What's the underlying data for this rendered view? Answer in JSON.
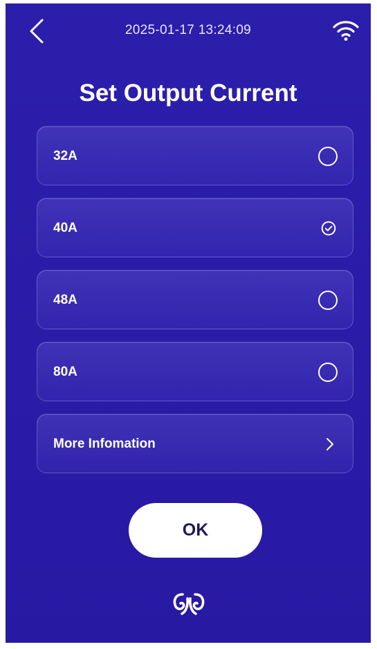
{
  "status_bar": {
    "datetime": "2025-01-17 13:24:09",
    "back_icon": "chevron-left-icon",
    "wifi_icon": "wifi-icon"
  },
  "title": "Set Output Current",
  "options": [
    {
      "label": "32A",
      "selected": false
    },
    {
      "label": "40A",
      "selected": true
    },
    {
      "label": "48A",
      "selected": false
    },
    {
      "label": "80A",
      "selected": false
    }
  ],
  "more_info": {
    "label": "More Infomation",
    "icon": "chevron-right-icon"
  },
  "ok_button": {
    "label": "OK"
  },
  "logo_icon": "brand-logo-icon",
  "colors": {
    "background": "#2a1ca8",
    "card_border": "#aaa5f5",
    "ok_text": "#1e1a5a"
  }
}
